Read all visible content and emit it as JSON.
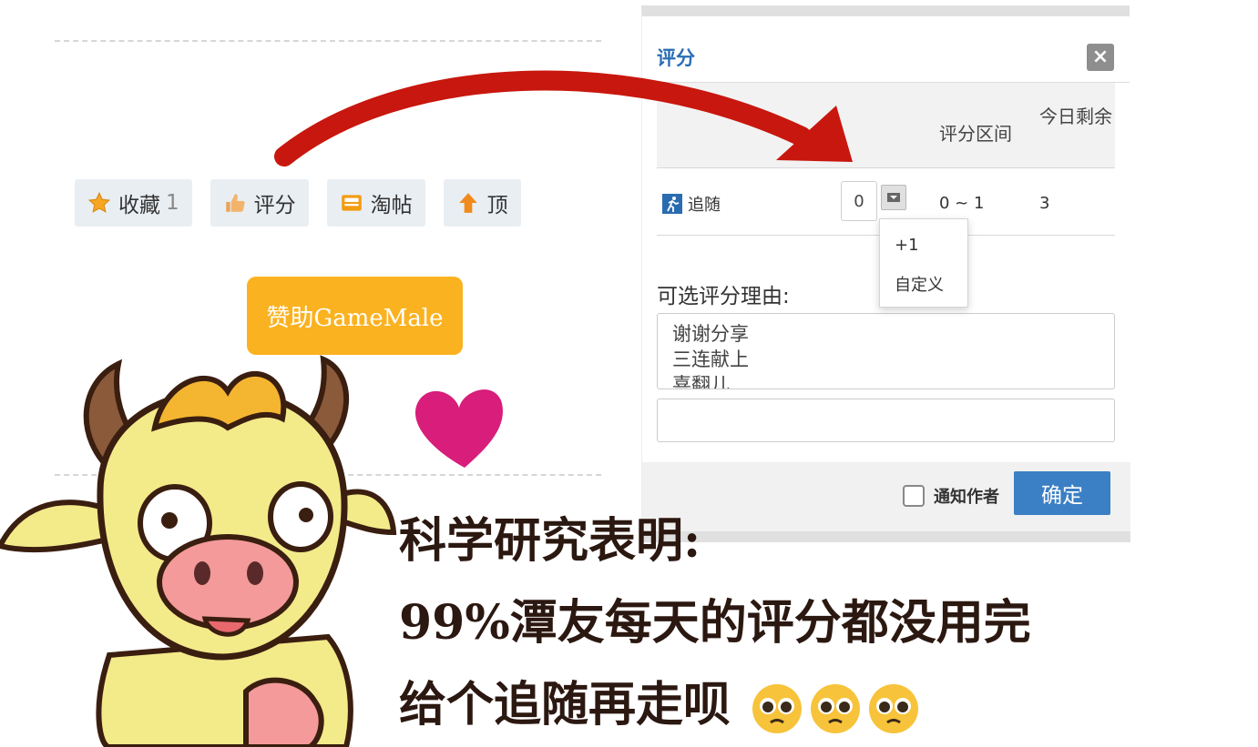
{
  "actions": [
    {
      "label": "收藏",
      "count": "1",
      "icon": "star-icon"
    },
    {
      "label": "评分",
      "icon": "thumbs-up-icon"
    },
    {
      "label": "淘帖",
      "icon": "tray-icon"
    },
    {
      "label": "顶",
      "icon": "arrow-up-icon"
    }
  ],
  "sponsor": {
    "label": "赞助GameMale"
  },
  "dialog": {
    "title": "评分",
    "close": "×",
    "table": {
      "header_range": "评分区间",
      "header_left": "今日剩余",
      "row": {
        "name": "追随",
        "value": "0",
        "range": "0 ~ 1",
        "left": "3"
      }
    },
    "dropdown": [
      "+1",
      "自定义"
    ],
    "reason_label": "可选评分理由:",
    "reasons": [
      "谢谢分享",
      "三连献上",
      "喜翻儿"
    ],
    "notify_label": "通知作者",
    "confirm_label": "确定"
  },
  "caption": {
    "line1": "科学研究表明:",
    "line2": "99%潭友每天的评分都没用完",
    "line3": "给个追随再走呗"
  },
  "colors": {
    "arrow": "#c8170e",
    "heart": "#d81d7b",
    "sponsor": "#fbb220",
    "confirm": "#3b7fc4",
    "title": "#2a6db5"
  }
}
